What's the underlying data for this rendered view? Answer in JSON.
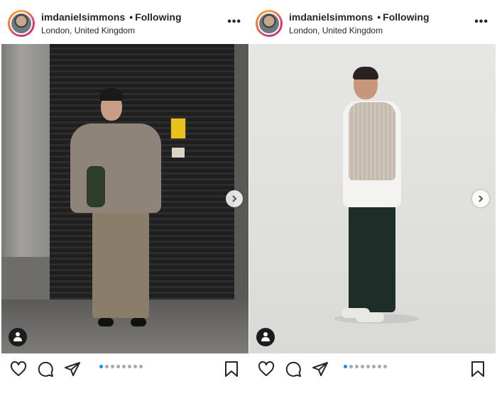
{
  "posts": [
    {
      "username": "imdanielsimmons",
      "separator": "•",
      "follow_status": "Following",
      "location": "London, United Kingdom",
      "more_label": "•••",
      "carousel": {
        "current_index": 1,
        "total": 8
      },
      "icons": [
        "heart-icon",
        "comment-icon",
        "share-icon",
        "bookmark-icon",
        "next-icon",
        "user-tag-icon"
      ]
    },
    {
      "username": "imdanielsimmons",
      "separator": "•",
      "follow_status": "Following",
      "location": "London, United Kingdom",
      "more_label": "•••",
      "carousel": {
        "current_index": 1,
        "total": 8
      },
      "icons": [
        "heart-icon",
        "comment-icon",
        "share-icon",
        "bookmark-icon",
        "next-icon",
        "user-tag-icon"
      ]
    }
  ],
  "colors": {
    "text": "#262626",
    "active_dot": "#0095f6",
    "inactive_dot": "#a8a8a8"
  }
}
